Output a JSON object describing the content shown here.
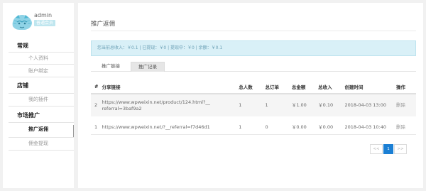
{
  "sidebar": {
    "username": "admin",
    "user_badge": "普通会员",
    "groups": [
      {
        "label": "常规",
        "items": [
          "个人资料",
          "账户绑定"
        ]
      },
      {
        "label": "店铺",
        "items": [
          "我的插件"
        ]
      },
      {
        "label": "市场推广",
        "items": [
          "推广返佣",
          "佣金提现"
        ]
      }
    ],
    "active_item": "推广返佣"
  },
  "main": {
    "title": "推广返佣",
    "alert": "您当前总收入：￥0.1 | 已提现：￥0 | 提现中：￥0 | 余额：￥0.1",
    "tabs": [
      "推广链接",
      "推广记录"
    ],
    "active_tab": "推广记录",
    "table": {
      "headers": [
        "#",
        "分享链接",
        "总人数",
        "总订单",
        "总金额",
        "总收入",
        "创建时间",
        "操作"
      ],
      "rows": [
        {
          "id": "2",
          "link": "https://www.wpweixin.net/product/124.html?__referral=3baf9a2",
          "people": "1",
          "orders": "1",
          "amount": "￥1.00",
          "income": "￥0.10",
          "created": "2018-04-03 13:00",
          "action": "删除"
        },
        {
          "id": "1",
          "link": "https://www.wpweixin.net/?__referral=f7d46d1",
          "people": "1",
          "orders": "0",
          "amount": "￥0.00",
          "income": "￥0.00",
          "created": "2018-04-03 10:40",
          "action": "删除"
        }
      ]
    },
    "pagination": {
      "prev": "<<",
      "current": "1",
      "next": ">>"
    }
  },
  "colors": {
    "accent": "#1b7fd4",
    "alert_bg": "#d9f0f7",
    "alert_text": "#6a9fb4",
    "badge_bg": "#bfe6ef"
  }
}
